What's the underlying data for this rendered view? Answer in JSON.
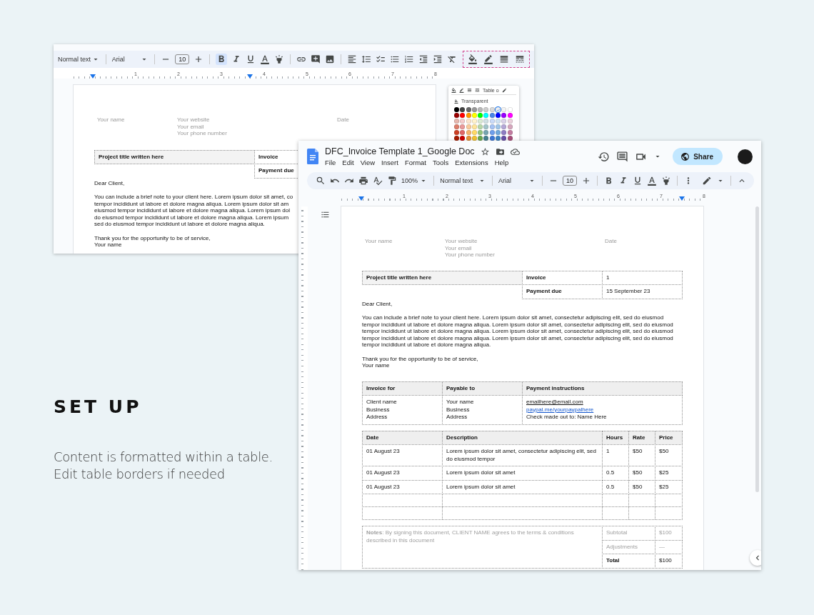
{
  "caption": {
    "heading": "SET UP",
    "lines": [
      "Content is formatted within a table.",
      "Edit table borders if needed"
    ]
  },
  "back_window": {
    "toolbar": {
      "style": "Normal text",
      "font": "Arial",
      "size": "10",
      "bold": true
    },
    "ruler": [
      "1",
      "2",
      "3",
      "4",
      "5",
      "6",
      "7",
      "8"
    ],
    "palette": {
      "tab": "Table o",
      "transparent": "Transparent",
      "swatches": [
        [
          {
            "color": "#000000",
            "selected": false
          },
          {
            "color": "#434343",
            "selected": false
          },
          {
            "color": "#666666",
            "selected": false
          },
          {
            "color": "#999999",
            "selected": false
          },
          {
            "color": "#b7b7b7",
            "selected": false
          },
          {
            "color": "#cccccc",
            "selected": false
          },
          {
            "color": "#d9d9d9",
            "selected": false
          },
          {
            "color": "#efefef",
            "selected": true
          },
          {
            "color": "#f3f3f3",
            "selected": false
          },
          {
            "color": "#ffffff",
            "selected": false
          }
        ],
        [
          {
            "color": "#980000",
            "selected": false
          },
          {
            "color": "#ff0000",
            "selected": false
          },
          {
            "color": "#ff9900",
            "selected": false
          },
          {
            "color": "#ffff00",
            "selected": false
          },
          {
            "color": "#00ff00",
            "selected": false
          },
          {
            "color": "#00ffff",
            "selected": false
          },
          {
            "color": "#4a86e8",
            "selected": false
          },
          {
            "color": "#0000ff",
            "selected": false
          },
          {
            "color": "#9900ff",
            "selected": false
          },
          {
            "color": "#ff00ff",
            "selected": false
          }
        ],
        [
          {
            "color": "#e6b8af",
            "selected": false
          },
          {
            "color": "#f4cccc",
            "selected": false
          },
          {
            "color": "#fce5cd",
            "selected": false
          },
          {
            "color": "#fff2cc",
            "selected": false
          },
          {
            "color": "#d9ead3",
            "selected": false
          },
          {
            "color": "#d0e0e3",
            "selected": false
          },
          {
            "color": "#c9daf8",
            "selected": false
          },
          {
            "color": "#cfe2f3",
            "selected": false
          },
          {
            "color": "#d9d2e9",
            "selected": false
          },
          {
            "color": "#ead1dc",
            "selected": false
          }
        ],
        [
          {
            "color": "#dd7e6b",
            "selected": false
          },
          {
            "color": "#ea9999",
            "selected": false
          },
          {
            "color": "#f9cb9c",
            "selected": false
          },
          {
            "color": "#ffe599",
            "selected": false
          },
          {
            "color": "#b6d7a8",
            "selected": false
          },
          {
            "color": "#a2c4c9",
            "selected": false
          },
          {
            "color": "#a4c2f4",
            "selected": false
          },
          {
            "color": "#9fc5e8",
            "selected": false
          },
          {
            "color": "#b4a7d6",
            "selected": false
          },
          {
            "color": "#d5a6bd",
            "selected": false
          }
        ],
        [
          {
            "color": "#cc4125",
            "selected": false
          },
          {
            "color": "#e06666",
            "selected": false
          },
          {
            "color": "#f6b26b",
            "selected": false
          },
          {
            "color": "#ffd966",
            "selected": false
          },
          {
            "color": "#93c47d",
            "selected": false
          },
          {
            "color": "#76a5af",
            "selected": false
          },
          {
            "color": "#6d9eeb",
            "selected": false
          },
          {
            "color": "#6fa8dc",
            "selected": false
          },
          {
            "color": "#8e7cc3",
            "selected": false
          },
          {
            "color": "#c27ba0",
            "selected": false
          }
        ],
        [
          {
            "color": "#a61c00",
            "selected": false
          },
          {
            "color": "#cc0000",
            "selected": false
          },
          {
            "color": "#e69138",
            "selected": false
          },
          {
            "color": "#f1c232",
            "selected": false
          },
          {
            "color": "#6aa84f",
            "selected": false
          },
          {
            "color": "#45818e",
            "selected": false
          },
          {
            "color": "#3c78d8",
            "selected": false
          },
          {
            "color": "#3d85c6",
            "selected": false
          },
          {
            "color": "#674ea7",
            "selected": false
          },
          {
            "color": "#a64d79",
            "selected": false
          }
        ]
      ]
    },
    "document": {
      "header": {
        "name": "Your name",
        "contact": [
          "Your website",
          "Your email",
          "Your phone number"
        ],
        "date": "Date"
      },
      "summary": [
        {
          "project": "Project title written here",
          "label": "Invoice"
        },
        {
          "label": "Payment due"
        }
      ],
      "greeting": "Dear Client,",
      "body_lines": [
        "You can include a brief note to your client here. Lorem ipsum dolor sit amet, co",
        "tempor incididunt ut labore et dolore magna aliqua. Lorem ipsum dolor sit am",
        "eiusmod tempor incididunt ut labore et dolore magna aliqua. Lorem ipsum dol",
        "do eiusmod tempor incididunt ut labore et dolore magna aliqua. Lorem ipsum",
        "sed do eiusmod tempor incididunt ut labore et dolore magna aliqua."
      ],
      "closing": [
        "Thank you for the opportunity to be of service,",
        "Your name"
      ]
    }
  },
  "front_window": {
    "title": "DFC_Invoice Template 1_Google Doc",
    "menu": [
      "File",
      "Edit",
      "View",
      "Insert",
      "Format",
      "Tools",
      "Extensions",
      "Help"
    ],
    "share": "Share",
    "toolbar": {
      "zoom": "100%",
      "style": "Normal text",
      "font": "Arial",
      "size": "10",
      "bold": false
    },
    "ruler": [
      "1",
      "2",
      "3",
      "4",
      "5",
      "6",
      "7",
      "8"
    ],
    "document": {
      "header": {
        "name": "Your name",
        "contact": [
          "Your website",
          "Your email",
          "Your phone number"
        ],
        "date": "Date"
      },
      "summary": [
        {
          "project": "Project title written here",
          "label": "Invoice",
          "value": "1"
        },
        {
          "label": "Payment due",
          "value": "15 September 23"
        }
      ],
      "greeting": "Dear Client,",
      "body": "You can include a brief note to your client here. Lorem ipsum dolor sit amet, consectetur adipiscing elit, sed do eiusmod tempor incididunt ut labore et dolore magna aliqua. Lorem ipsum dolor sit amet, consectetur adipiscing elit, sed do eiusmod tempor incididunt ut labore et dolore magna aliqua. Lorem ipsum dolor sit amet, consectetur adipiscing elit, sed do eiusmod tempor incididunt ut labore et dolore magna aliqua. Lorem ipsum dolor sit amet, consectetur adipiscing elit, sed do eiusmod tempor incididunt ut labore et dolore magna aliqua.",
      "closing": [
        "Thank you for the opportunity to be of service,",
        "Your name"
      ],
      "billing": [
        {
          "heading": "Invoice for",
          "lines": [
            {
              "text": "Client name",
              "kind": "text"
            },
            {
              "text": "Business",
              "kind": "text"
            },
            {
              "text": "Address",
              "kind": "text"
            }
          ]
        },
        {
          "heading": "Payable to",
          "lines": [
            {
              "text": "Your name",
              "kind": "text"
            },
            {
              "text": "Business",
              "kind": "text"
            },
            {
              "text": "Address",
              "kind": "text"
            }
          ]
        },
        {
          "heading": "Payment instructions",
          "lines": [
            {
              "text": "emailhere@email.com",
              "kind": "email"
            },
            {
              "text": "paypal.me/yourpaypalhere",
              "kind": "link"
            },
            {
              "text": "Check made out to: Name Here",
              "kind": "text"
            }
          ]
        }
      ],
      "items": {
        "columns": [
          "Date",
          "Description",
          "Hours",
          "Rate",
          "Price"
        ],
        "rows": [
          {
            "kind": "item",
            "cells": [
              "01 August 23",
              "Lorem ipsum dolor sit amet, consectetur adipiscing elit, sed do eiusmod tempor",
              "1",
              "$50",
              "$50"
            ]
          },
          {
            "kind": "item",
            "cells": [
              "01 August 23",
              "Lorem ipsum dolor sit amet",
              "0.5",
              "$50",
              "$25"
            ]
          },
          {
            "kind": "item",
            "cells": [
              "01 August 23",
              "Lorem ipsum dolor sit amet",
              "0.5",
              "$50",
              "$25"
            ]
          },
          {
            "kind": "blank"
          },
          {
            "kind": "blank"
          }
        ]
      },
      "totals": {
        "notes": "**Notes**: By signing this document, CLIENT NAME agrees to the terms & conditions described in this document",
        "rows": [
          {
            "label": "Subtotal",
            "value": "$100",
            "muted": true
          },
          {
            "label": "Adjustments",
            "value": "—",
            "muted": true
          },
          {
            "label": "Total",
            "value": "$100",
            "muted": false
          }
        ]
      }
    }
  }
}
